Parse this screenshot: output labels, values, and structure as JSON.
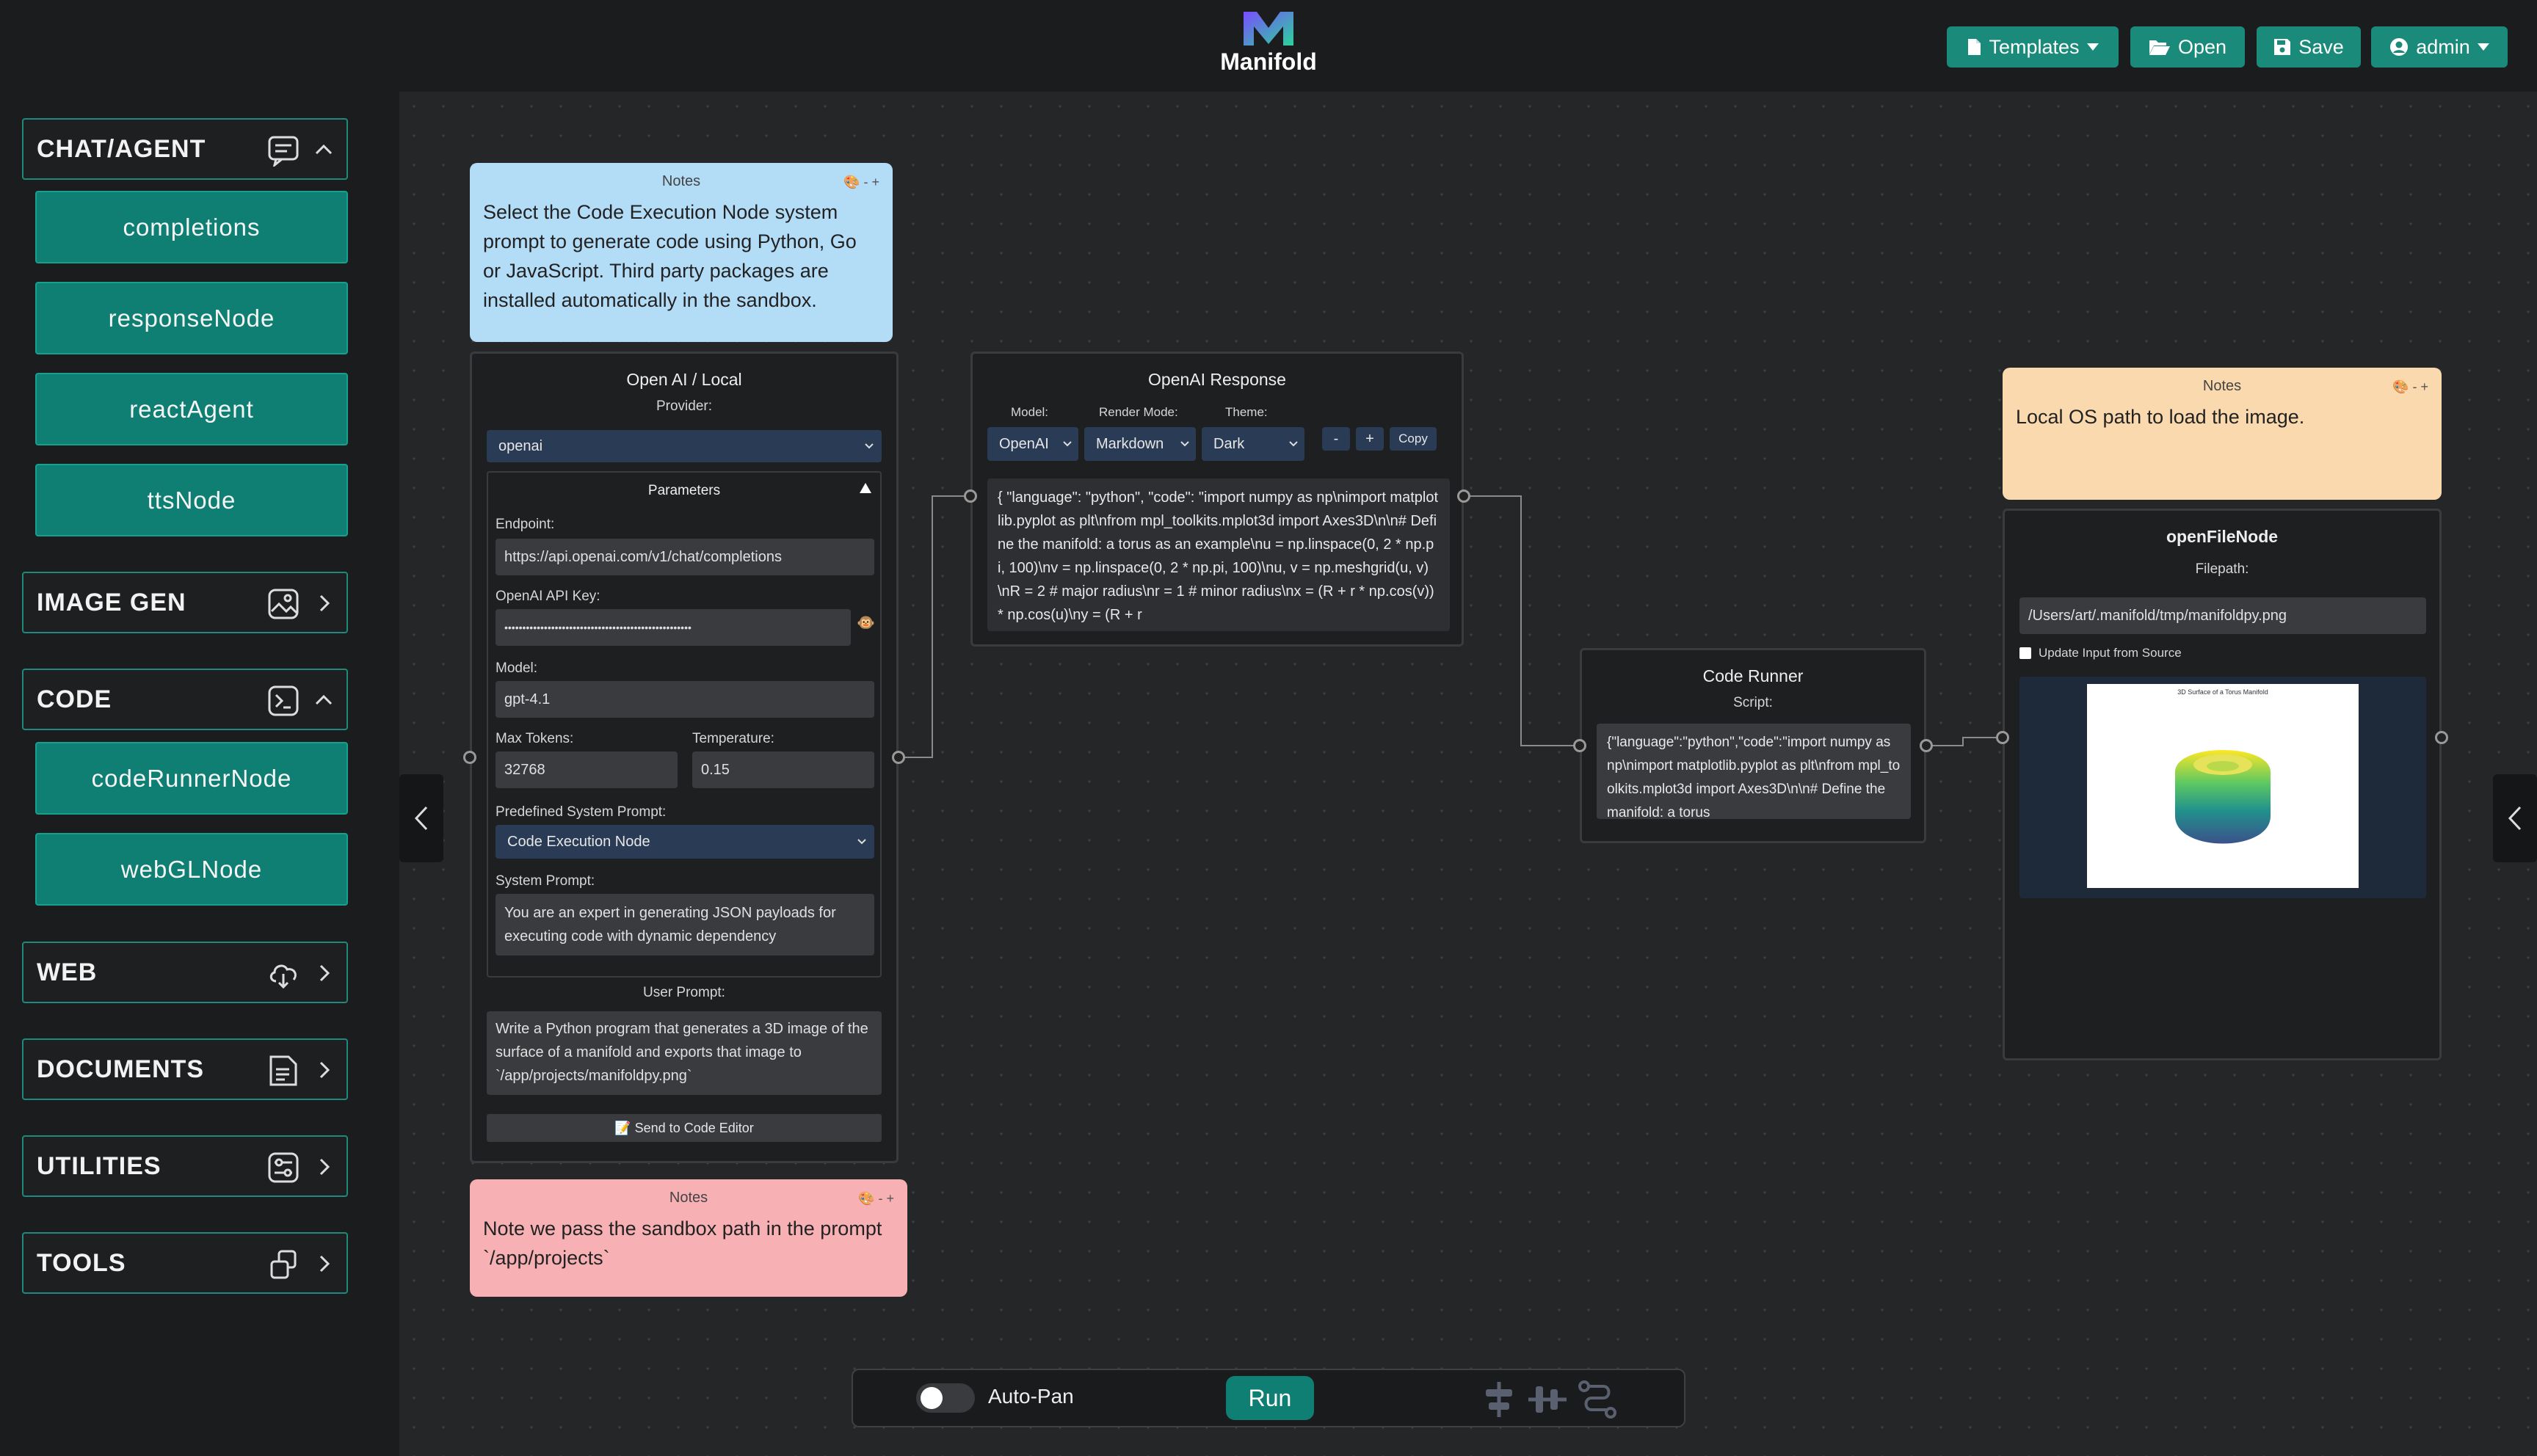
{
  "app": {
    "title": "Manifold"
  },
  "header": {
    "templates_label": "Templates",
    "open_label": "Open",
    "save_label": "Save",
    "user_label": "admin",
    "accent": "#1a8a7a"
  },
  "sidebar": {
    "categories": [
      {
        "label": "CHAT/AGENT",
        "icon": "chat-icon",
        "expanded": true
      },
      {
        "label": "IMAGE GEN",
        "icon": "image-icon",
        "expanded": false
      },
      {
        "label": "CODE",
        "icon": "terminal-icon",
        "expanded": true
      },
      {
        "label": "WEB",
        "icon": "cloud-icon",
        "expanded": false
      },
      {
        "label": "DOCUMENTS",
        "icon": "document-icon",
        "expanded": false
      },
      {
        "label": "UTILITIES",
        "icon": "sliders-icon",
        "expanded": false
      },
      {
        "label": "TOOLS",
        "icon": "tools-icon",
        "expanded": false
      }
    ],
    "chat_items": [
      "completions",
      "responseNode",
      "reactAgent",
      "ttsNode"
    ],
    "code_items": [
      "codeRunnerNode",
      "webGLNode"
    ]
  },
  "notes": {
    "note1": {
      "header": "Notes",
      "controls": "🎨 - +",
      "text": "Select the Code Execution Node system prompt to generate code using Python, Go or JavaScript. Third party packages are installed automatically in the sandbox.",
      "color": "#b3dcf7"
    },
    "note2": {
      "header": "Notes",
      "controls": "🎨 - +",
      "text": "Note we pass the sandbox path in the prompt `/app/projects`",
      "color": "#f7b1b5"
    },
    "note3": {
      "header": "Notes",
      "controls": "🎨 - +",
      "text": "Local OS path to load the image.",
      "color": "#fbd9ae"
    }
  },
  "openai_node": {
    "title": "Open AI / Local",
    "provider_label": "Provider:",
    "provider": "openai",
    "params_title": "Parameters",
    "endpoint_label": "Endpoint:",
    "endpoint": "https://api.openai.com/v1/chat/completions",
    "api_key_label": "OpenAI API Key:",
    "api_key": "••••••••••••••••••••••••••••••••••••••••••••••••••••",
    "model_label": "Model:",
    "model": "gpt-4.1",
    "max_tokens_label": "Max Tokens:",
    "max_tokens": "32768",
    "temperature_label": "Temperature:",
    "temperature": "0.15",
    "predefined_label": "Predefined System Prompt:",
    "predefined": "Code Execution Node",
    "system_prompt_label": "System Prompt:",
    "system_prompt": "You are an expert in generating JSON payloads for executing code with dynamic dependency",
    "user_prompt_label": "User Prompt:",
    "user_prompt": "Write a Python program that generates a 3D image of the surface of a manifold and exports that image to `/app/projects/manifoldpy.png`",
    "send_label": "📝 Send to Code Editor"
  },
  "response_node": {
    "title": "OpenAI Response",
    "model_label": "Model:",
    "render_label": "Render Mode:",
    "theme_label": "Theme:",
    "model": "OpenAI",
    "render": "Markdown",
    "theme": "Dark",
    "minus": "-",
    "plus": "+",
    "copy": "Copy",
    "content": "{ \"language\": \"python\", \"code\": \"import numpy as np\\nimport matplotlib.pyplot as plt\\nfrom mpl_toolkits.mplot3d import Axes3D\\n\\n# Define the manifold: a torus as an example\\nu = np.linspace(0, 2 * np.pi, 100)\\nv = np.linspace(0, 2 * np.pi, 100)\\nu, v = np.meshgrid(u, v)\\nR = 2 # major radius\\nr = 1 # minor radius\\nx = (R + r * np.cos(v)) * np.cos(u)\\ny = (R + r"
  },
  "code_runner": {
    "title": "Code Runner",
    "script_label": "Script:",
    "script": "{\"language\":\"python\",\"code\":\"import numpy as np\\nimport matplotlib.pyplot as plt\\nfrom mpl_toolkits.mplot3d import Axes3D\\n\\n# Define the manifold: a torus"
  },
  "open_file_node": {
    "title": "openFileNode",
    "filepath_label": "Filepath:",
    "filepath": "/Users/art/.manifold/tmp/manifoldpy.png",
    "update_label": "Update Input from Source",
    "preview_caption": "3D Surface of a Torus Manifold"
  },
  "bottombar": {
    "autopan_label": "Auto-Pan",
    "autopan_on": false,
    "run_label": "Run"
  }
}
